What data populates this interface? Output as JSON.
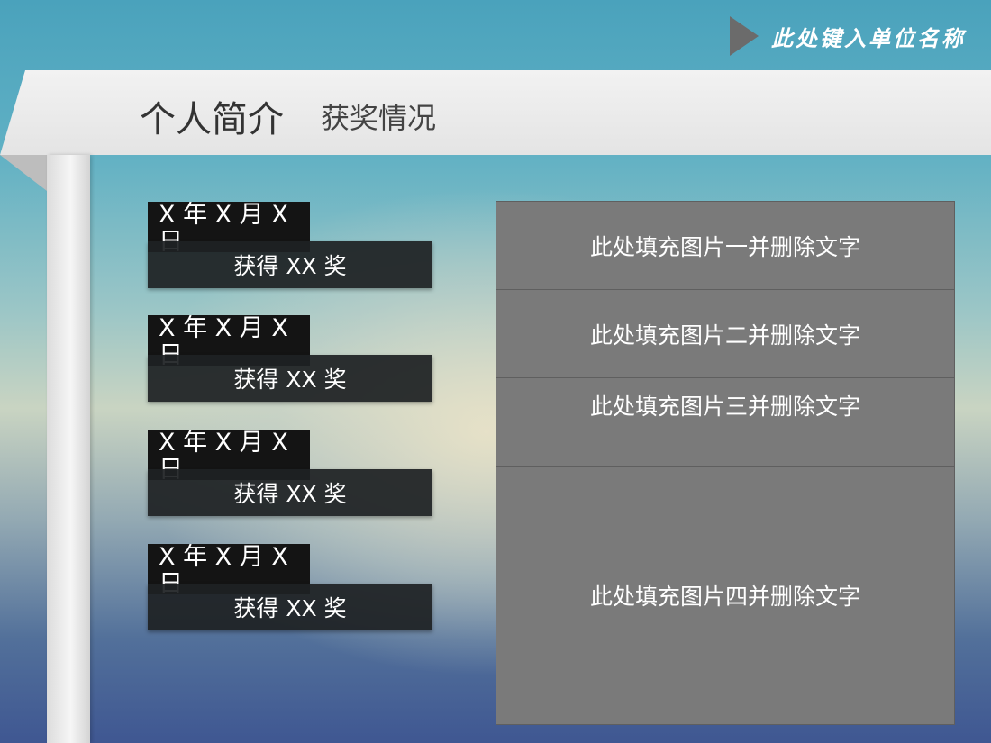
{
  "brand": {
    "name": "此处键入单位名称"
  },
  "header": {
    "title": "个人简介",
    "subtitle": "获奖情况"
  },
  "awards": [
    {
      "date": "X 年 X 月 X 日",
      "label": "获得 XX 奖"
    },
    {
      "date": "X 年 X 月 X 日",
      "label": "获得 XX 奖"
    },
    {
      "date": "X 年 X 月 X 日",
      "label": "获得 XX 奖"
    },
    {
      "date": "X 年 X 月 X 日",
      "label": "获得 XX 奖"
    }
  ],
  "pictures": [
    {
      "text": "此处填充图片一并删除文字"
    },
    {
      "text": "此处填充图片二并删除文字"
    },
    {
      "text": "此处填充图片三并删除文字"
    },
    {
      "text": "此处填充图片四并删除文字"
    }
  ],
  "colors": {
    "banner": "#ececec",
    "pillar": "#f0f0f0",
    "award_date_bg": "#141414",
    "award_label_bg": "#1e2123",
    "picture_placeholder": "#7a7a7a",
    "brand_triangle": "#6b6b6b"
  },
  "icons": {
    "brand_marker": "triangle-right-icon"
  }
}
